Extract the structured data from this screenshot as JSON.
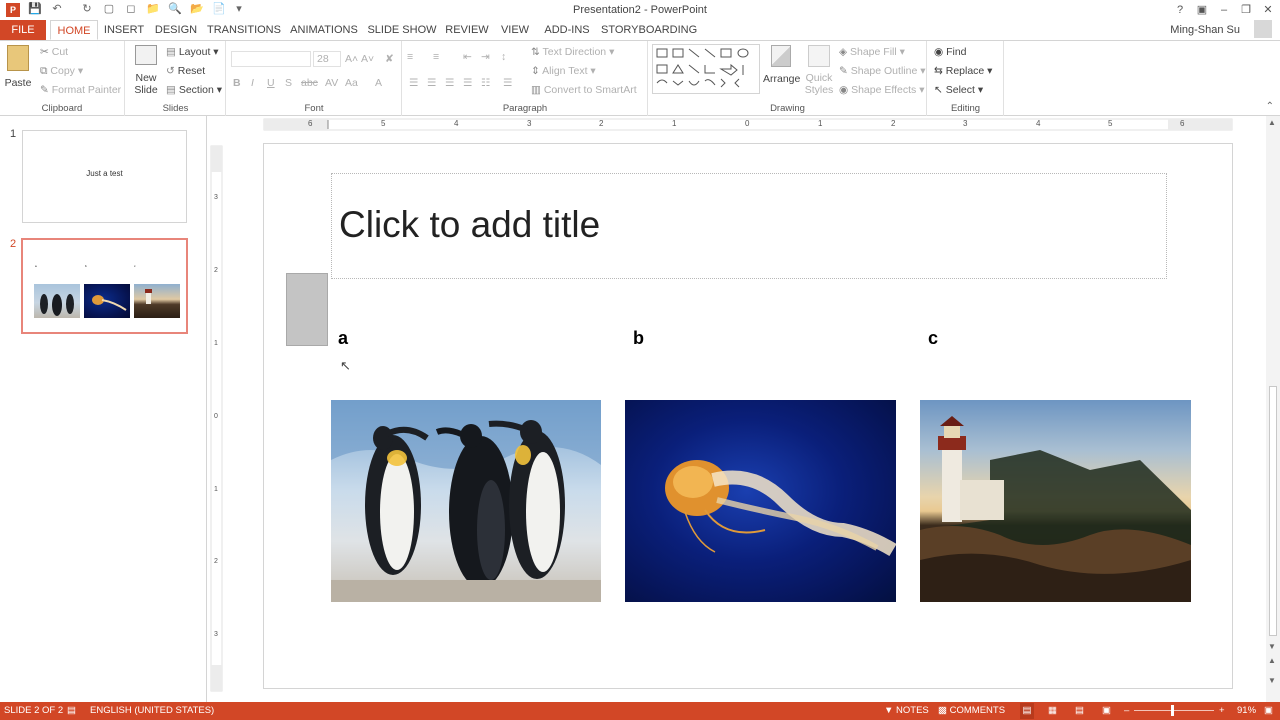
{
  "window": {
    "title": "Presentation2 - PowerPoint"
  },
  "user": {
    "name": "Ming-Shan Su"
  },
  "tabs": [
    "FILE",
    "HOME",
    "INSERT",
    "DESIGN",
    "TRANSITIONS",
    "ANIMATIONS",
    "SLIDE SHOW",
    "REVIEW",
    "VIEW",
    "ADD-INS",
    "STORYBOARDING"
  ],
  "ribbon": {
    "clipboard": {
      "label": "Clipboard",
      "paste": "Paste",
      "cut": "Cut",
      "copy": "Copy",
      "format_painter": "Format Painter"
    },
    "slides": {
      "label": "Slides",
      "new_slide_1": "New",
      "new_slide_2": "Slide",
      "layout": "Layout",
      "reset": "Reset",
      "section": "Section"
    },
    "font": {
      "label": "Font",
      "size": "28"
    },
    "paragraph": {
      "label": "Paragraph",
      "text_direction": "Text Direction",
      "align_text": "Align Text",
      "convert_smartart": "Convert to SmartArt"
    },
    "drawing": {
      "label": "Drawing",
      "arrange": "Arrange",
      "quick_1": "Quick",
      "quick_2": "Styles",
      "shape_fill": "Shape Fill",
      "shape_outline": "Shape Outline",
      "shape_effects": "Shape Effects"
    },
    "editing": {
      "label": "Editing",
      "find": "Find",
      "replace": "Replace",
      "select": "Select"
    }
  },
  "ruler": {
    "h_ticks": [
      "6",
      "5",
      "4",
      "3",
      "2",
      "1",
      "0",
      "1",
      "2",
      "3",
      "4",
      "5",
      "6"
    ],
    "v_ticks": [
      "3",
      "2",
      "1",
      "0",
      "1",
      "2",
      "3"
    ]
  },
  "thumbnails": [
    {
      "number": "1",
      "text": "Just a test"
    },
    {
      "number": "2",
      "labels": [
        "a",
        "b",
        "c"
      ]
    }
  ],
  "slide": {
    "title_placeholder": "Click to add title",
    "labels": [
      "a",
      "b",
      "c"
    ],
    "images": [
      "penguins",
      "jellyfish",
      "lighthouse"
    ]
  },
  "status": {
    "slide_info": "SLIDE 2 OF 2",
    "language": "ENGLISH (UNITED STATES)",
    "notes": "NOTES",
    "comments": "COMMENTS",
    "zoom": "91%"
  },
  "colors": {
    "accent": "#d24726",
    "border": "#d4d4d4"
  }
}
